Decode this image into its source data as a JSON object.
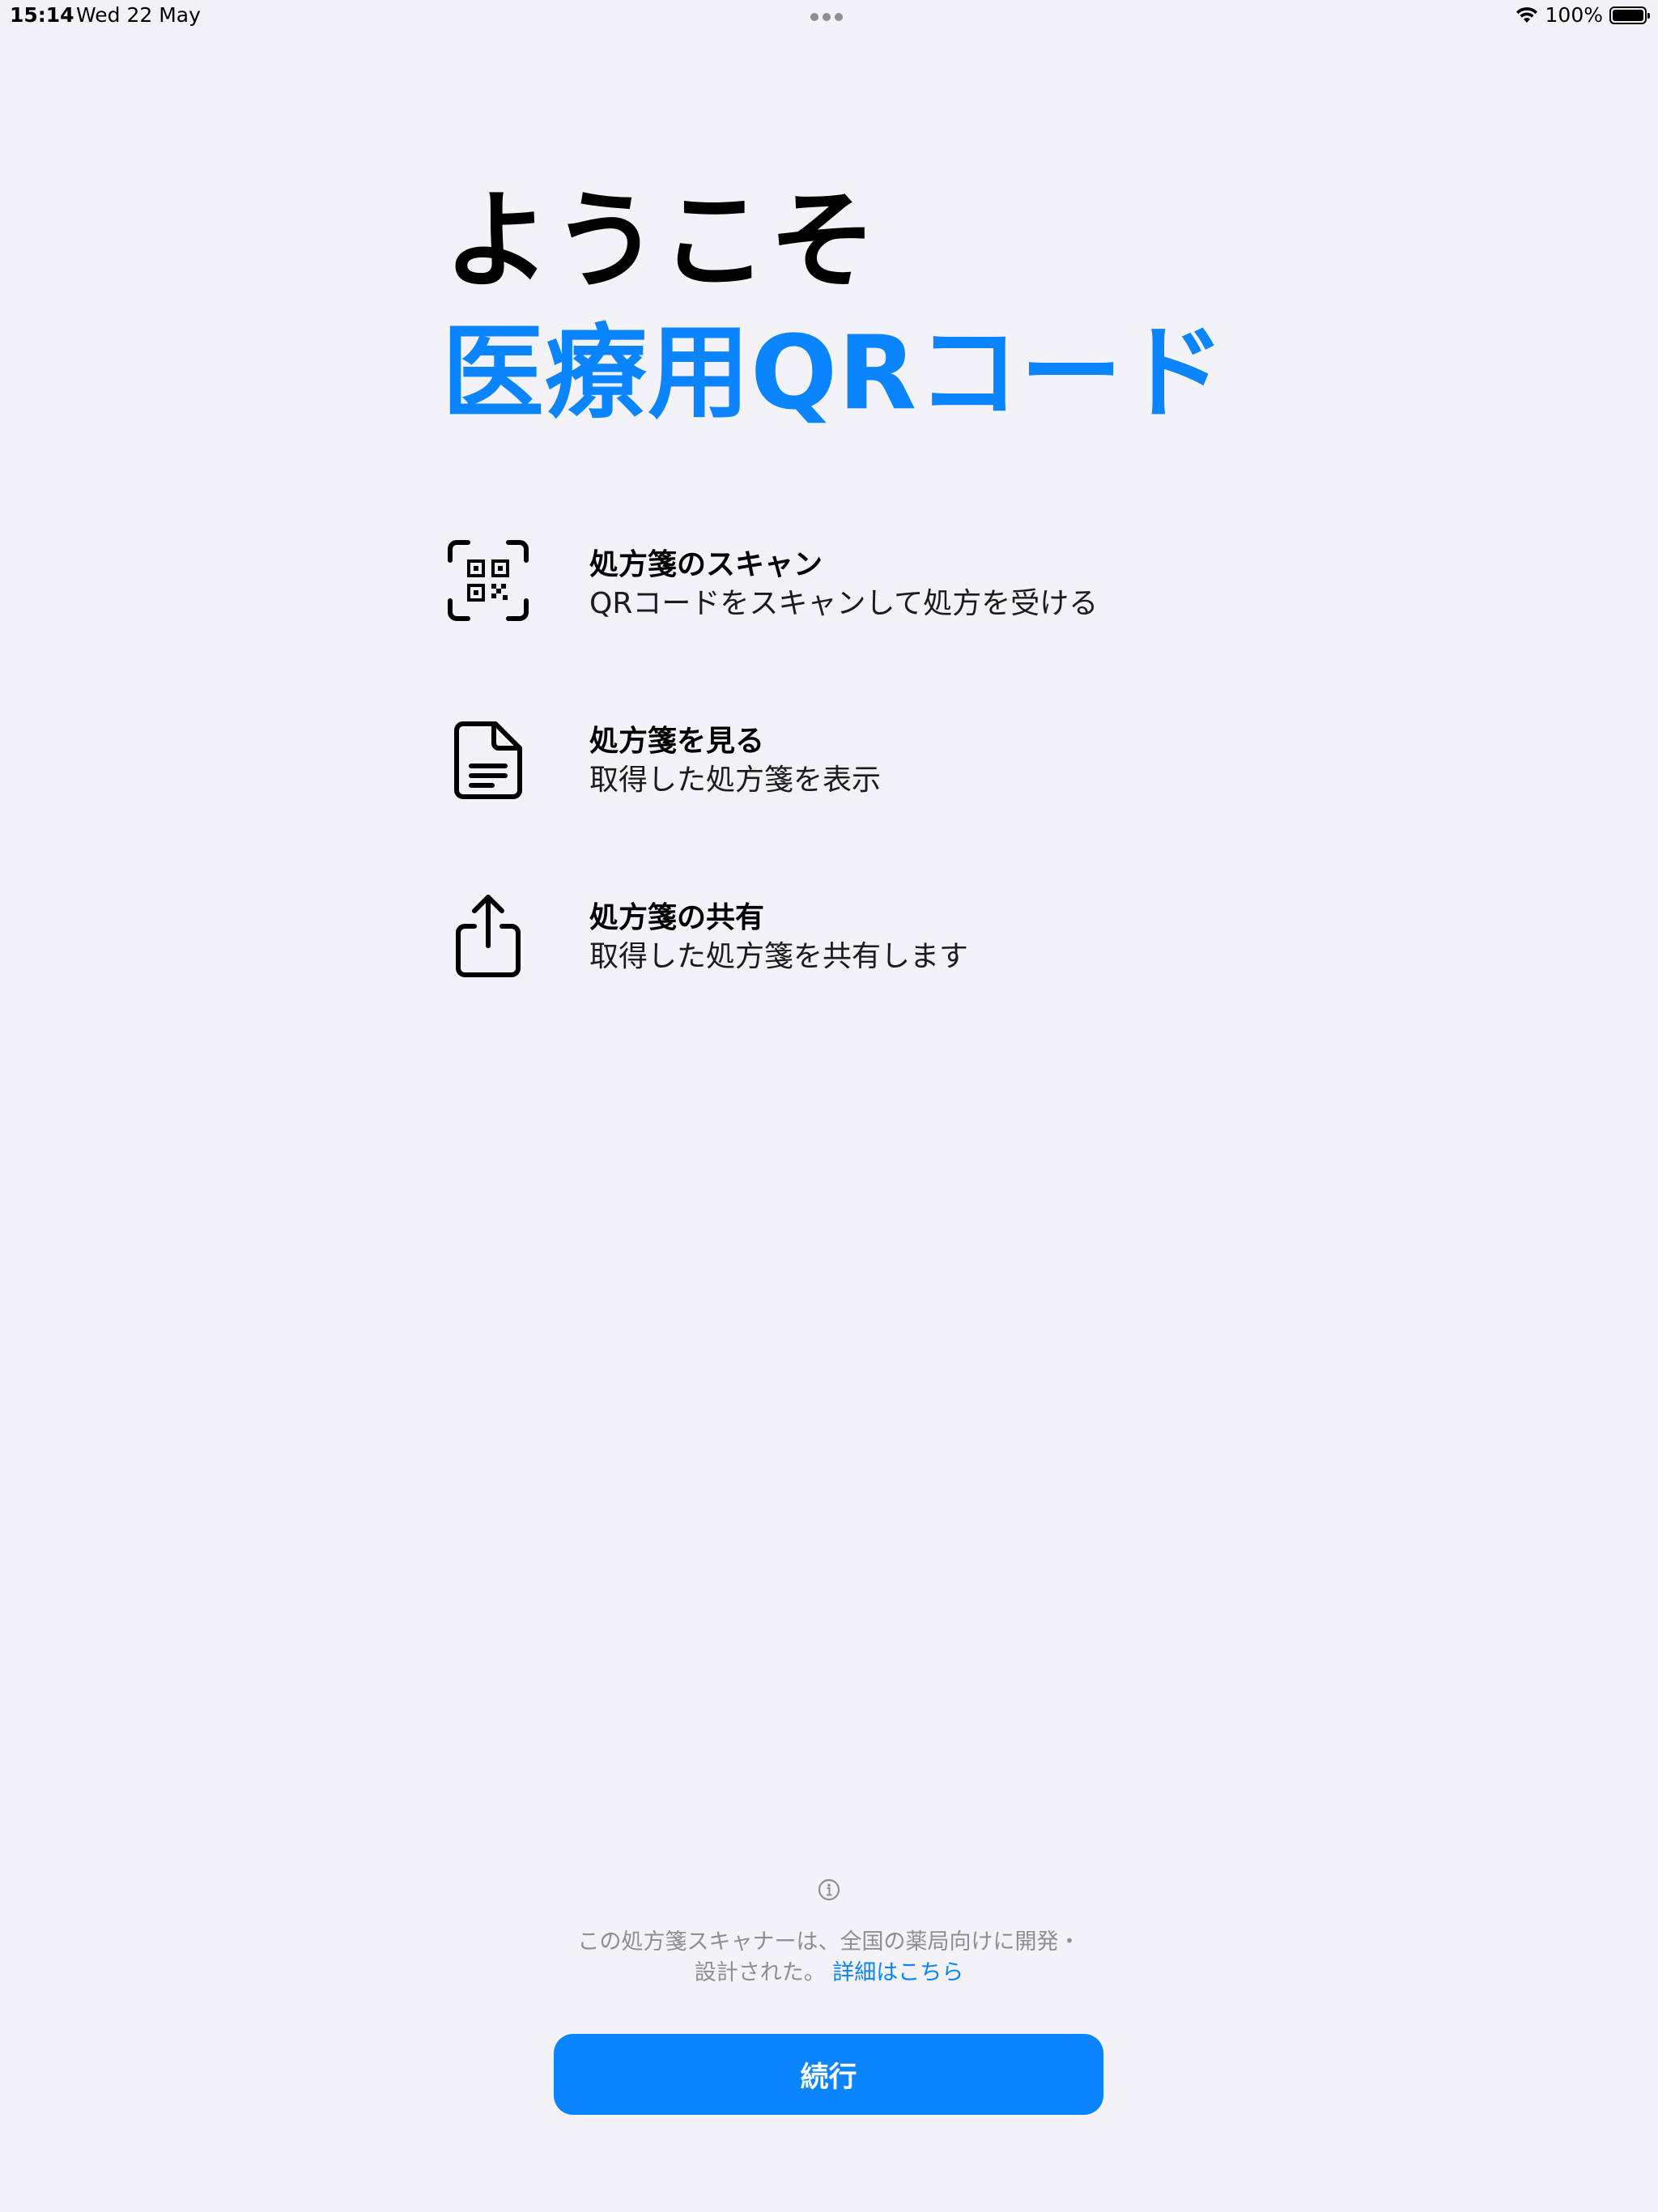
{
  "status_bar": {
    "time": "15:14",
    "date": "Wed 22 May",
    "battery": "100%"
  },
  "title": {
    "line1": "ようこそ",
    "line2": "医療用QRコード",
    "accent_color": "#0a84ff"
  },
  "features": [
    {
      "icon": "qr-code-scan-icon",
      "title": "処方箋のスキャン",
      "description": "QRコードをスキャンして処方を受ける"
    },
    {
      "icon": "document-icon",
      "title": "処方箋を見る",
      "description": "取得した処方箋を表示"
    },
    {
      "icon": "share-icon",
      "title": "処方箋の共有",
      "description": "取得した処方箋を共有します"
    }
  ],
  "footer": {
    "info_line1": "この処方箋スキャナーは、全国の薬局向けに開発・",
    "info_line2": "設計された。",
    "details_link": "詳細はこちら",
    "continue_label": "続行"
  }
}
